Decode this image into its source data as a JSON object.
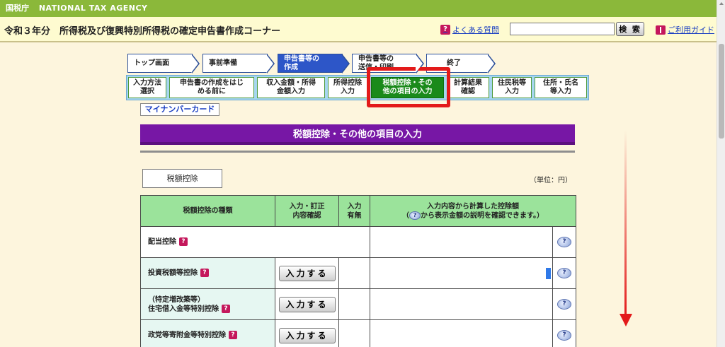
{
  "agency": {
    "name_jp": "国税庁",
    "name_en": "NATIONAL TAX AGENCY"
  },
  "header": {
    "title": "令和３年分　所得税及び復興特別所得税の確定申告書作成コーナー",
    "faq_label": "よくある質問",
    "search_placeholder": "",
    "search_button": "検 索",
    "guide_label": "ご利用ガイド"
  },
  "top_steps": [
    {
      "label": "トップ画面"
    },
    {
      "label": "事前準備"
    },
    {
      "label_line1": "申告書等の",
      "label_line2": "作成"
    },
    {
      "label_line1": "申告書等の",
      "label_line2": "送信・印刷"
    },
    {
      "label": "終了"
    }
  ],
  "sub_steps": [
    {
      "line1": "入力方法",
      "line2": "選択"
    },
    {
      "line1": "申告書の作成をはじ",
      "line2": "める前に"
    },
    {
      "line1": "収入金額・所得",
      "line2": "金額入力"
    },
    {
      "line1": "所得控除",
      "line2": "入力"
    },
    {
      "line1": "税額控除・その",
      "line2": "他の項目の入力"
    },
    {
      "line1": "計算結果",
      "line2": "確認"
    },
    {
      "line1": "住民税等",
      "line2": "入力"
    },
    {
      "line1": "住所・氏名",
      "line2": "等入力"
    }
  ],
  "mynumber_label": "マイナンバーカード",
  "section": {
    "title": "税額控除・その他の項目の入力",
    "tab": "税額控除",
    "unit": "（単位：円）"
  },
  "table": {
    "headers": {
      "kind": "税額控除の種類",
      "confirm_line1": "入力・訂正",
      "confirm_line2": "内容確認",
      "exists_line1": "入力",
      "exists_line2": "有無",
      "amount_line1": "入力内容から計算した控除額",
      "amount_line2_pre": "（",
      "amount_line2_post": "から表示金額の説明を確認できます。）"
    },
    "rows": [
      {
        "kind_line1": "配当控除",
        "kind_line2": ""
      },
      {
        "kind_line1": "投資税額等控除",
        "kind_line2": "",
        "button": "入力する"
      },
      {
        "kind_line1": "（特定増改築等）",
        "kind_line2": "住宅借入金等特別控除",
        "button": "入力する"
      },
      {
        "kind_line1": "政党等寄附金等特別控除",
        "kind_line2": "",
        "button": "入力する"
      }
    ]
  },
  "icons": {
    "help_mark": "?",
    "bubble_mark": "?"
  },
  "colors": {
    "agency_bar": "#8bb83a",
    "section_header": "#7717a5",
    "table_header": "#9be39b",
    "highlight": "#e31a1a"
  }
}
